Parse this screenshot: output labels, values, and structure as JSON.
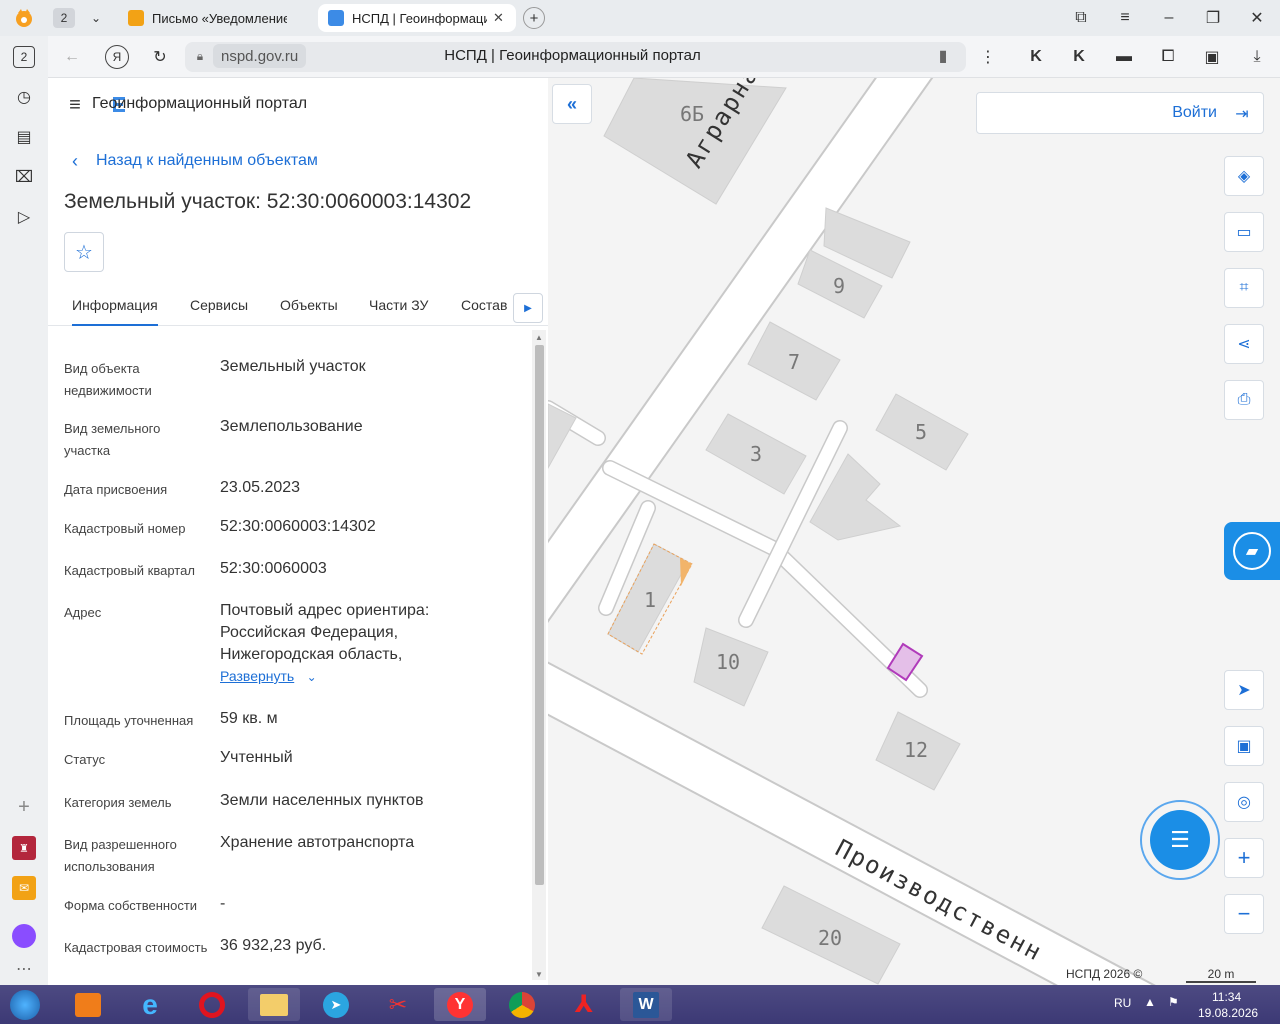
{
  "browser": {
    "tab_count": "2",
    "tabs": [
      {
        "title": "Письмо «Уведомление о",
        "active": false
      },
      {
        "title": "НСПД | Геоинформацио",
        "active": true
      }
    ],
    "url_host": "nspd.gov.ru",
    "page_title": "НСПД | Геоинформационный портал",
    "sidebar_badge": "2"
  },
  "panel": {
    "brand": "Геоинформационный портал",
    "back_link": "Назад к найденным объектам",
    "title": "Земельный участок: 52:30:0060003:14302",
    "tabs": [
      "Информация",
      "Сервисы",
      "Объекты",
      "Части ЗУ",
      "Состав"
    ],
    "rows": [
      {
        "label": "Вид объекта недвижимости",
        "value": "Земельный участок"
      },
      {
        "label": "Вид земельного участка",
        "value": "Землепользование"
      },
      {
        "label": "Дата присвоения",
        "value": "23.05.2023"
      },
      {
        "label": "Кадастровый номер",
        "value": "52:30:0060003:14302"
      },
      {
        "label": "Кадастровый квартал",
        "value": "52:30:0060003"
      },
      {
        "label": "Адрес",
        "value": "Почтовый адрес ориентира: Российская Федерация, Нижегородская область,"
      },
      {
        "label": "Площадь уточненная",
        "value": "59 кв. м"
      },
      {
        "label": "Статус",
        "value": "Учтенный"
      },
      {
        "label": "Категория земель",
        "value": "Земли населенных пунктов"
      },
      {
        "label": "Вид разрешенного использования",
        "value": "Хранение автотранспорта"
      },
      {
        "label": "Форма собственности",
        "value": "-"
      },
      {
        "label": "Кадастровая стоимость",
        "value": "36 932,23 руб."
      }
    ],
    "expand_link": "Развернуть"
  },
  "map": {
    "login": "Войти",
    "streets": [
      "Аграрная улиц",
      "Производственн"
    ],
    "buildings": [
      "6Б",
      "9",
      "7",
      "5",
      "3",
      "1",
      "10",
      "12",
      "20"
    ],
    "copyright": "НСПД 2026 ©",
    "scale": "20 m"
  },
  "taskbar": {
    "lang": "RU",
    "time": "11:34",
    "date": "19.08.2026"
  },
  "colors": {
    "accent": "#1d6fd6",
    "map_bg": "#f4f4f4",
    "building": "#dddddd",
    "road": "#ffffff",
    "selected_parcel": "#c33fcb"
  }
}
